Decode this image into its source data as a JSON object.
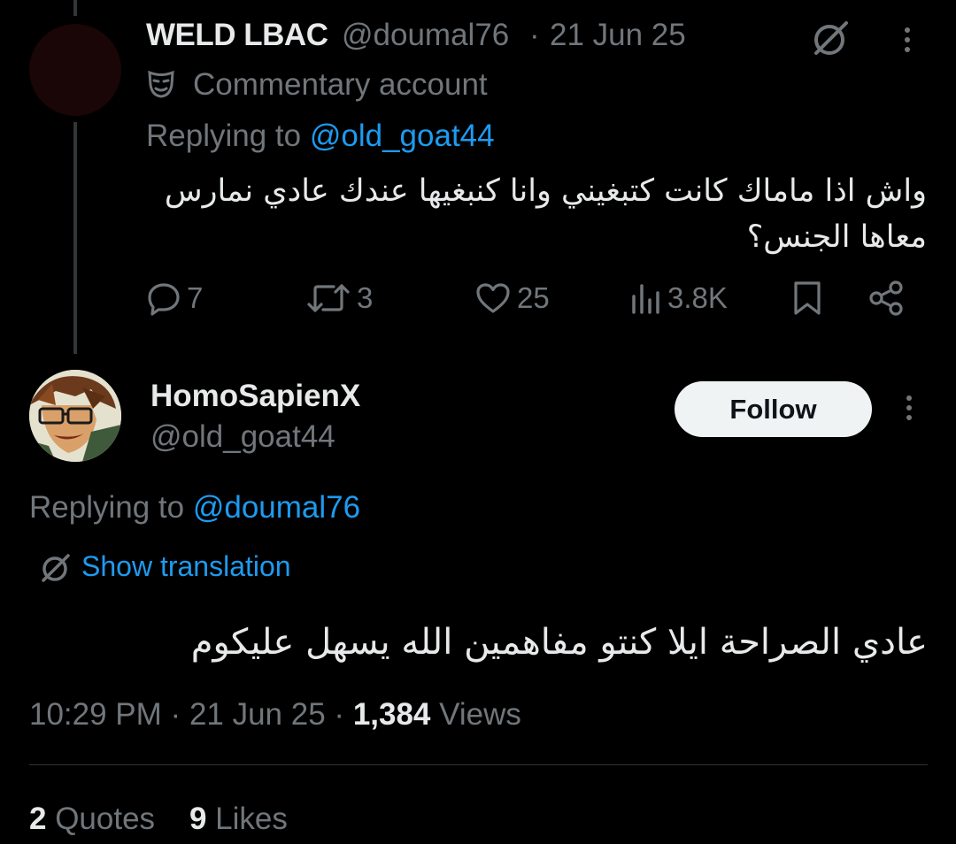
{
  "reply_tweet": {
    "display_name": "WELD LBAC",
    "handle": "@doumal76",
    "separator": "·",
    "date": "21 Jun 25",
    "account_label": "Commentary account",
    "replying_prefix": "Replying to",
    "replying_to": "@old_goat44",
    "text": "واش اذا ماماك كانت كتبغيني وانا كنبغيها عندك عادي نمارس معاها الجنس؟",
    "actions": {
      "replies": "7",
      "reposts": "3",
      "likes": "25",
      "views": "3.8K"
    }
  },
  "main_tweet": {
    "display_name": "HomoSapienX",
    "handle": "@old_goat44",
    "follow_label": "Follow",
    "replying_prefix": "Replying to",
    "replying_to": "@doumal76",
    "translate_label": "Show translation",
    "text": "عادي الصراحة ايلا كنتو مفاهمين الله يسهل عليكوم",
    "time": "10:29 PM",
    "date": "21 Jun 25",
    "separator": "·",
    "views_count": "1,384",
    "views_label": "Views",
    "quotes_count": "2",
    "quotes_label": "Quotes",
    "likes_count": "9",
    "likes_label": "Likes"
  },
  "colors": {
    "background": "#000000",
    "text": "#e7e9ea",
    "muted": "#71767b",
    "link": "#1d9bf0",
    "follow_bg": "#eff3f4"
  },
  "icons": [
    "grok-icon",
    "more-icon",
    "mask-icon",
    "reply-icon",
    "repost-icon",
    "like-icon",
    "views-icon",
    "bookmark-icon",
    "share-icon",
    "translate-icon"
  ]
}
